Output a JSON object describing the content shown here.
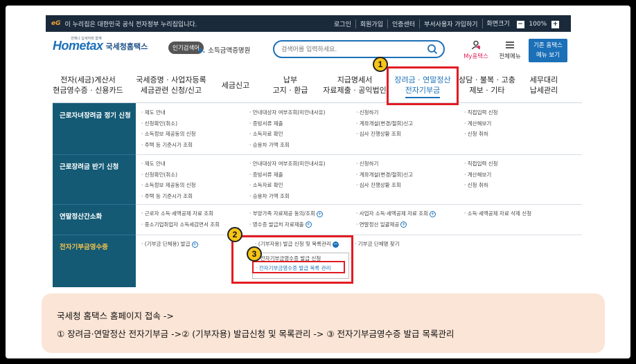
{
  "gov_bar": {
    "logo_mark": "eG",
    "notice": "이 누리집은 대한민국 공식 전자정부 누리집입니다.",
    "links": [
      "로그인",
      "회원가입",
      "인증센터",
      "부서사용자 가입하기"
    ],
    "zoom_label": "화면크기",
    "zoom_out": "−",
    "zoom_value": "100%",
    "zoom_in": "+"
  },
  "header": {
    "logo_sub": "언제나 납세자와 함께",
    "logo_main": "Hometax",
    "logo_brand": "국세청홈택스",
    "popular_label": "인기검색어",
    "popular_rank": "4.",
    "popular_term": "소득금액증명원",
    "search_placeholder": "검색어를 입력하세요.",
    "my_hometax": "My홈택스",
    "all_menu": "전체메뉴",
    "classic_line1": "기존 홈택스",
    "classic_line2": "메뉴 보기"
  },
  "nav": [
    {
      "l1": "전자(세금)계산서",
      "l2": "현금영수증 · 신용카드"
    },
    {
      "l1": "국세증명 · 사업자등록",
      "l2": "세금관련 신청/신고"
    },
    {
      "l1": "세금신고",
      "l2": ""
    },
    {
      "l1": "납부",
      "l2": "고지 · 환급"
    },
    {
      "l1": "지급명세서",
      "l2": "자료제출 · 공익법인"
    },
    {
      "l1": "장려금 · 연말정산",
      "l2": "전자기부금"
    },
    {
      "l1": "상담 · 불복 · 고충",
      "l2": "제보 · 기타"
    },
    {
      "l1": "세무대리",
      "l2": "납세관리"
    }
  ],
  "panel": {
    "rows": [
      {
        "title": "근로자녀장려금 정기 신청",
        "cols": [
          [
            "· 제도 안내",
            "· 신청확인(취소)",
            "· 소득정보 제공동의 신청",
            "· 주택 등 기준시가 조회"
          ],
          [
            "· 안내대상자 여부조회(미안내사유)",
            "· 증빙서류 제출",
            "· 소득자료 확인",
            "· 승용차 가액 조회"
          ],
          [
            "· 신청하기",
            "· 계좌개설(변경/철회)신고",
            "· 심사 진행상황 조회"
          ],
          [
            "· 직접입력 신청",
            "· 계산해보기",
            "· 신청 취하"
          ]
        ]
      },
      {
        "title": "근로장려금 반기 신청",
        "cols": [
          [
            "· 제도 안내",
            "· 신청확인(취소)",
            "· 소득정보 제공동의 신청",
            "· 주택 등 기준시가 조회"
          ],
          [
            "· 안내대상자 여부조회(미안내사유)",
            "· 증빙서류 제출",
            "· 소득자료 확인",
            "· 승용차 가액 조회"
          ],
          [
            "· 신청하기",
            "· 계좌개설(변경/철회)신고",
            "· 심사 진행상황 조회"
          ],
          [
            "· 직접입력 신청",
            "· 계산해보기",
            "· 신청 취하"
          ]
        ]
      },
      {
        "title": "연말정산간소화",
        "cols": [
          [
            "· 근로자 소득·세액공제 자료 조회",
            "· 중소기업취업자 소득세감면서 조회"
          ],
          [
            "· 부양가족 자료제공 동의/조회",
            "· 영수증 발급처 자료제출"
          ],
          [
            "· 사업자 소득·세액공제 자료 조회",
            "· 연말정산 일괄제공"
          ],
          [
            "· 소득·세액공제 자료 삭제 신청"
          ]
        ]
      },
      {
        "title": "전자기부금영수증",
        "cols": [
          [
            "· (기부금 단체용) 발급"
          ],
          [
            "· (기부자용) 발급 신청 및 목록관리"
          ],
          [
            "· 기부금 단체명 찾기"
          ]
        ],
        "submenu": [
          "· 전자기부금영수증 발급 신청",
          "· 전자기부금영수증 발급 목록 관리"
        ]
      }
    ]
  },
  "badges": [
    "1",
    "2",
    "3"
  ],
  "caption": {
    "line1": "국세청 홈택스 홈페이지 접속 ->",
    "line2": "① 장려금·연말정산 전자기부금 ->② (기부자용) 발급신청 및 목록관리 -> ③ 전자기부금영수증 발급 목록관리"
  },
  "colors": {
    "accent": "#1b70b8",
    "panel_side": "#145a75",
    "highlight": "#e21b23",
    "badge": "#f5c518",
    "caption_bg": "#fbe5d6"
  }
}
